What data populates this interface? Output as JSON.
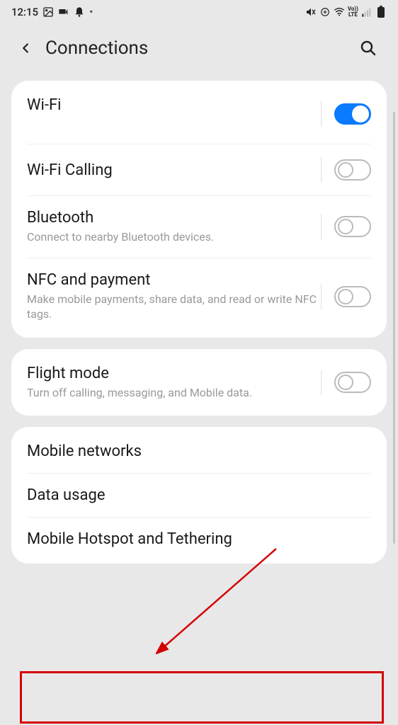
{
  "statusbar": {
    "time": "12:15"
  },
  "header": {
    "title": "Connections"
  },
  "groups": [
    {
      "rows": [
        {
          "title": "Wi-Fi",
          "sub": "",
          "toggle": true,
          "toggleOn": true
        },
        {
          "title": "Wi-Fi Calling",
          "sub": "",
          "toggle": true,
          "toggleOn": false
        },
        {
          "title": "Bluetooth",
          "sub": "Connect to nearby Bluetooth devices.",
          "toggle": true,
          "toggleOn": false
        },
        {
          "title": "NFC and payment",
          "sub": "Make mobile payments, share data, and read or write NFC tags.",
          "toggle": true,
          "toggleOn": false
        }
      ]
    },
    {
      "rows": [
        {
          "title": "Flight mode",
          "sub": "Turn off calling, messaging, and Mobile data.",
          "toggle": true,
          "toggleOn": false
        }
      ]
    },
    {
      "rows": [
        {
          "title": "Mobile networks",
          "sub": "",
          "toggle": false
        },
        {
          "title": "Data usage",
          "sub": "",
          "toggle": false
        },
        {
          "title": "Mobile Hotspot and Tethering",
          "sub": "",
          "toggle": false
        }
      ]
    }
  ]
}
